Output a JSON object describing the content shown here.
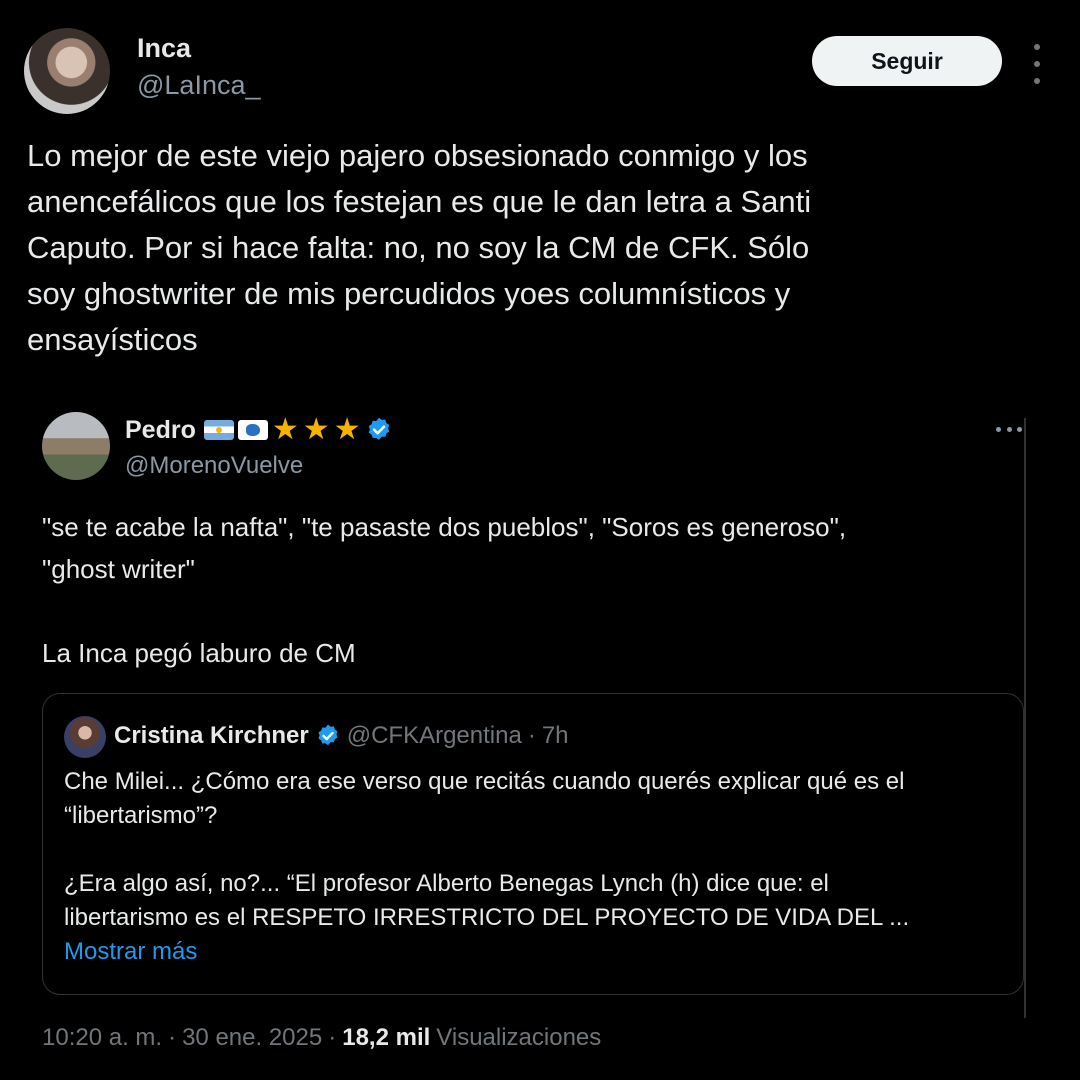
{
  "tweet": {
    "author": {
      "name": "Inca",
      "handle": "@LaInca_"
    },
    "follow_label": "Seguir",
    "text": "Lo mejor de este viejo pajero obsesionado conmigo y los\nanencefálicos que los festejan es que le dan letra a Santi\nCaputo. Por si hace falta: no, no soy la CM de CFK. Sólo\nsoy ghostwriter de mis percudidos yoes columnísticos y\nensayísticos",
    "time": "10:20 a. m.",
    "date": "30 ene. 2025",
    "separator": "·",
    "views_count": "18,2 mil",
    "views_label": "Visualizaciones"
  },
  "quote": {
    "author": {
      "name": "Pedro",
      "handle": "@MorenoVuelve",
      "badges": [
        "flag-argentina-icon",
        "flag-malvinas-icon",
        "star-icon",
        "star-icon",
        "star-icon",
        "verified-badge-icon"
      ]
    },
    "text": "\"se te acabe la nafta\", \"te pasaste dos pueblos\", \"Soros es generoso\",\n\"ghost writer\"\n\nLa Inca pegó laburo de CM"
  },
  "nested_quote": {
    "author": {
      "name": "Cristina Kirchner",
      "handle": "@CFKArgentina",
      "time": "7h",
      "separator": "·"
    },
    "text": "Che Milei... ¿Cómo era ese verso que recitás cuando querés explicar qué es el\n“libertarismo”?\n\n¿Era algo así, no?... “El profesor Alberto Benegas Lynch (h) dice que: el\nlibertarismo es el RESPETO IRRESTRICTO DEL PROYECTO DE VIDA DEL ...",
    "show_more_label": "Mostrar más"
  },
  "colors": {
    "background": "#000000",
    "text_primary": "#e7e9ea",
    "text_secondary": "#8b98a5",
    "link": "#1d9bf0",
    "verified": "#1d9bf0",
    "follow_button_bg": "#eff3f4",
    "border": "#2f3336"
  }
}
